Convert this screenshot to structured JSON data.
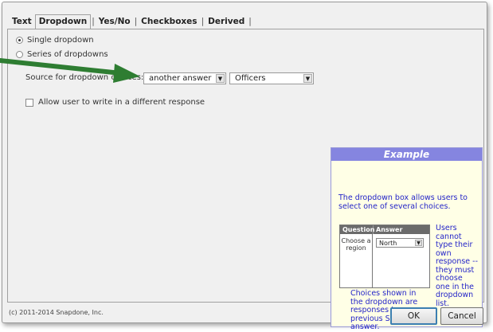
{
  "tabs": [
    {
      "label": "Text",
      "active": false
    },
    {
      "label": "Dropdown",
      "active": true
    },
    {
      "label": "Yes/No",
      "active": false
    },
    {
      "label": "Checkboxes",
      "active": false
    },
    {
      "label": "Derived",
      "active": false
    }
  ],
  "options": {
    "single_dropdown": "Single dropdown",
    "series_of_dropdowns": "Series of dropdowns",
    "selected": "single_dropdown"
  },
  "source": {
    "label": "Source for dropdown choices:",
    "source_type_value": "another answer",
    "source_list_value": "Officers"
  },
  "allow_write_in": {
    "label": "Allow user to write in a different response",
    "checked": false
  },
  "example": {
    "title": "Example",
    "intro": "The dropdown box allows users to select one of several choices.",
    "table": {
      "col_question": "Question",
      "col_answer": "Answer",
      "question_text": "Choose a region",
      "answer_value": "North"
    },
    "side_note": "Users cannot type their own response -- they must choose one in the dropdown list.",
    "bottom_note": "Choices shown in the dropdown are responses to a previous Series answer."
  },
  "footer": {
    "copyright": "(c) 2011-2014 Snapdone, Inc.",
    "ok_label": "OK",
    "cancel_label": "Cancel"
  },
  "colors": {
    "example_header": "#8585e0",
    "example_text": "#2424c8",
    "callout_arrow": "#2e7d32"
  }
}
